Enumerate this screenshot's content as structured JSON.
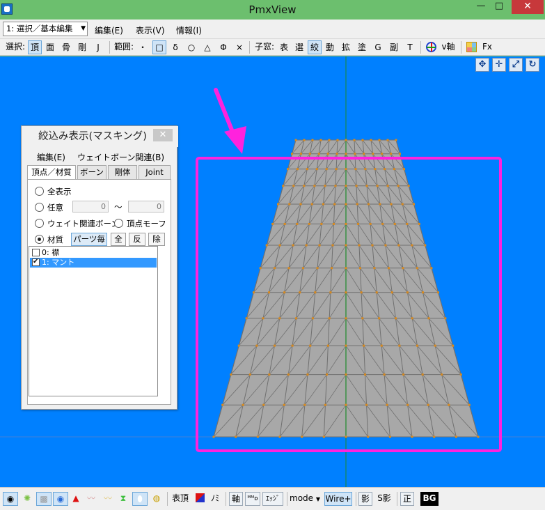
{
  "window": {
    "title": "PmxView",
    "minimize_glyph": "—",
    "maximize_glyph": "□",
    "close_glyph": "✕"
  },
  "menubar": {
    "mode_selected": "1: 選択／基本編集",
    "items": [
      "編集(E)",
      "表示(V)",
      "情報(I)"
    ]
  },
  "toolbar": {
    "select_label": "選択:",
    "select_items": [
      "頂",
      "面",
      "骨",
      "剛",
      "J"
    ],
    "select_active": "頂",
    "range_label": "範囲:",
    "range_items": [
      "・",
      "□",
      "δ",
      "○",
      "△",
      "Φ",
      "×"
    ],
    "range_active": "□",
    "subwindow_label": "子窓:",
    "subwindow_items": [
      "表",
      "選",
      "絞",
      "動",
      "拡",
      "塗",
      "G",
      "副",
      "T"
    ],
    "subwindow_active": "絞",
    "axis_label": "v軸",
    "fx_label": "Fx"
  },
  "viewport": {
    "background": "#0080ff",
    "mesh_fill": "#a8a8a8",
    "mesh_line": "#707070",
    "vertex_color": "#d98a1e",
    "center_axis_color": "#1e8a2a",
    "highlight_color": "#ff22dd",
    "tools": [
      "✥",
      "✛",
      "⤢",
      "↻"
    ]
  },
  "dialog": {
    "title": "絞込み表示(マスキング)",
    "close_glyph": "✕",
    "menu": [
      "編集(E)",
      "ウェイトボーン関連(B)"
    ],
    "tabs": [
      "頂点／材質",
      "ボーン",
      "剛体",
      "Joint"
    ],
    "active_tab": "頂点／材質",
    "options": {
      "show_all": "全表示",
      "any": "任意",
      "any_from": "0",
      "range_sep": "〜",
      "any_to": "0",
      "weight_bone": "ウェイト関連ボーン",
      "vertex_morph": "頂点モーフ",
      "material": "材質",
      "per_part_button": "パーツ毎",
      "all_button": "全",
      "invert_button": "反",
      "remove_button": "除"
    },
    "materials": [
      {
        "label": "0: 襟",
        "checked": false,
        "selected": false
      },
      {
        "label": "1: マント",
        "checked": true,
        "selected": true
      }
    ]
  },
  "bottombar": {
    "vertex_label": "表頂",
    "no_label": "ﾉﾐ",
    "axis_button": "軸",
    "mb_button": "ᴹᴹᴅ",
    "edge_button": "ｴｯｼﾞ",
    "mode_label": "mode",
    "wire_button": "Wire+",
    "shadow_button": "影",
    "sshadow_button": "S影",
    "ortho_button": "正",
    "bg_button": "BG"
  }
}
